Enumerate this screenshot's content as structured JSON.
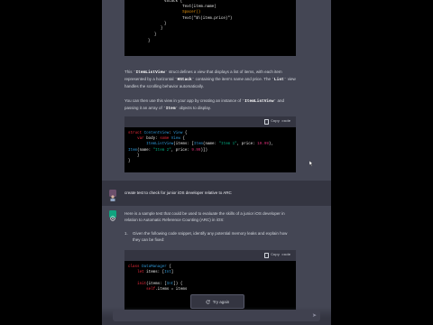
{
  "code_top": {
    "lines": [
      "VStack {",
      "    Text(item.name)",
      "    Spacer()",
      "    Text(\"$\\(item.price)\")",
      "}",
      "}",
      "}",
      "}"
    ]
  },
  "para1": {
    "t1": "This ",
    "c1": "`ItemListView`",
    "t2": " struct defines a view that displays a list of items, with each item represented by a horizontal ",
    "c2": "`HStack`",
    "t3": " containing the item's name and price. The ",
    "c3": "`List`",
    "t4": " view handles the scrolling behavior automatically."
  },
  "para2": {
    "t1": "You can then use this view in your app by creating an instance of ",
    "c1": "`ItemListView`",
    "t2": " and passing it an array of ",
    "c2": "`Item`",
    "t3": " objects to display."
  },
  "code_mid": {
    "copy_label": "Copy code"
  },
  "user_message": "create test to check for junior iOS developer relative to ARC",
  "reply": {
    "intro": "Here is a sample test that could be used to evaluate the skills of a junior iOS developer in relation to Automatic Reference Counting (ARC) in iOS:",
    "item_number": "1.",
    "item_text": "Given the following code snippet, identify any potential memory leaks and explain how they can be fixed:"
  },
  "code_bottom": {
    "copy_label": "Copy code"
  },
  "retry_label": "Try again",
  "icons": {
    "copy": "copy-icon",
    "retry": "refresh-icon",
    "send": "send-icon"
  },
  "colors": {
    "assistant_bg": "#444654",
    "user_bg": "#343541",
    "assistant_avatar": "#10a37f"
  }
}
